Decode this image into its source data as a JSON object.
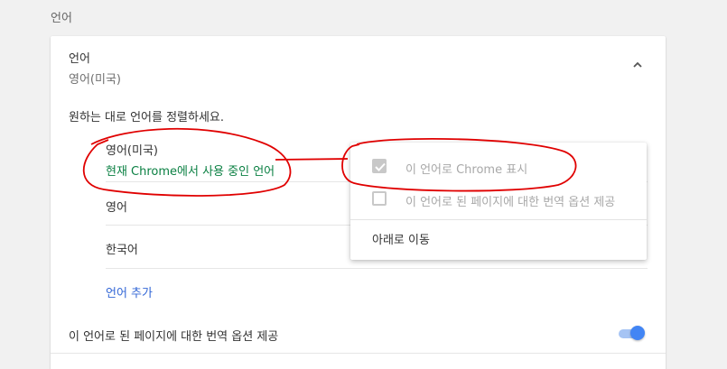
{
  "section": {
    "title": "언어"
  },
  "languages_card": {
    "title": "언어",
    "subtitle": "영어(미국)",
    "instructions": "원하는 대로 언어를 정렬하세요.",
    "items": [
      {
        "name": "영어(미국)",
        "note": "현재 Chrome에서 사용 중인 언어"
      },
      {
        "name": "영어"
      },
      {
        "name": "한국어"
      }
    ],
    "add_language": "언어 추가",
    "translate_label": "이 언어로 된 페이지에 대한 번역 옵션 제공",
    "translate_enabled": true
  },
  "context_menu": {
    "display_in_chrome": {
      "label": "이 언어로 Chrome 표시",
      "checked": true,
      "disabled": true
    },
    "offer_translate": {
      "label": "이 언어로 된 페이지에 대한 번역 옵션 제공",
      "checked": false,
      "disabled": true
    },
    "move_down": "아래로 이동"
  },
  "colors": {
    "accent": "#4285f4",
    "link": "#3367d6",
    "note_green": "#0b8043",
    "annotation_red": "#e00000"
  }
}
